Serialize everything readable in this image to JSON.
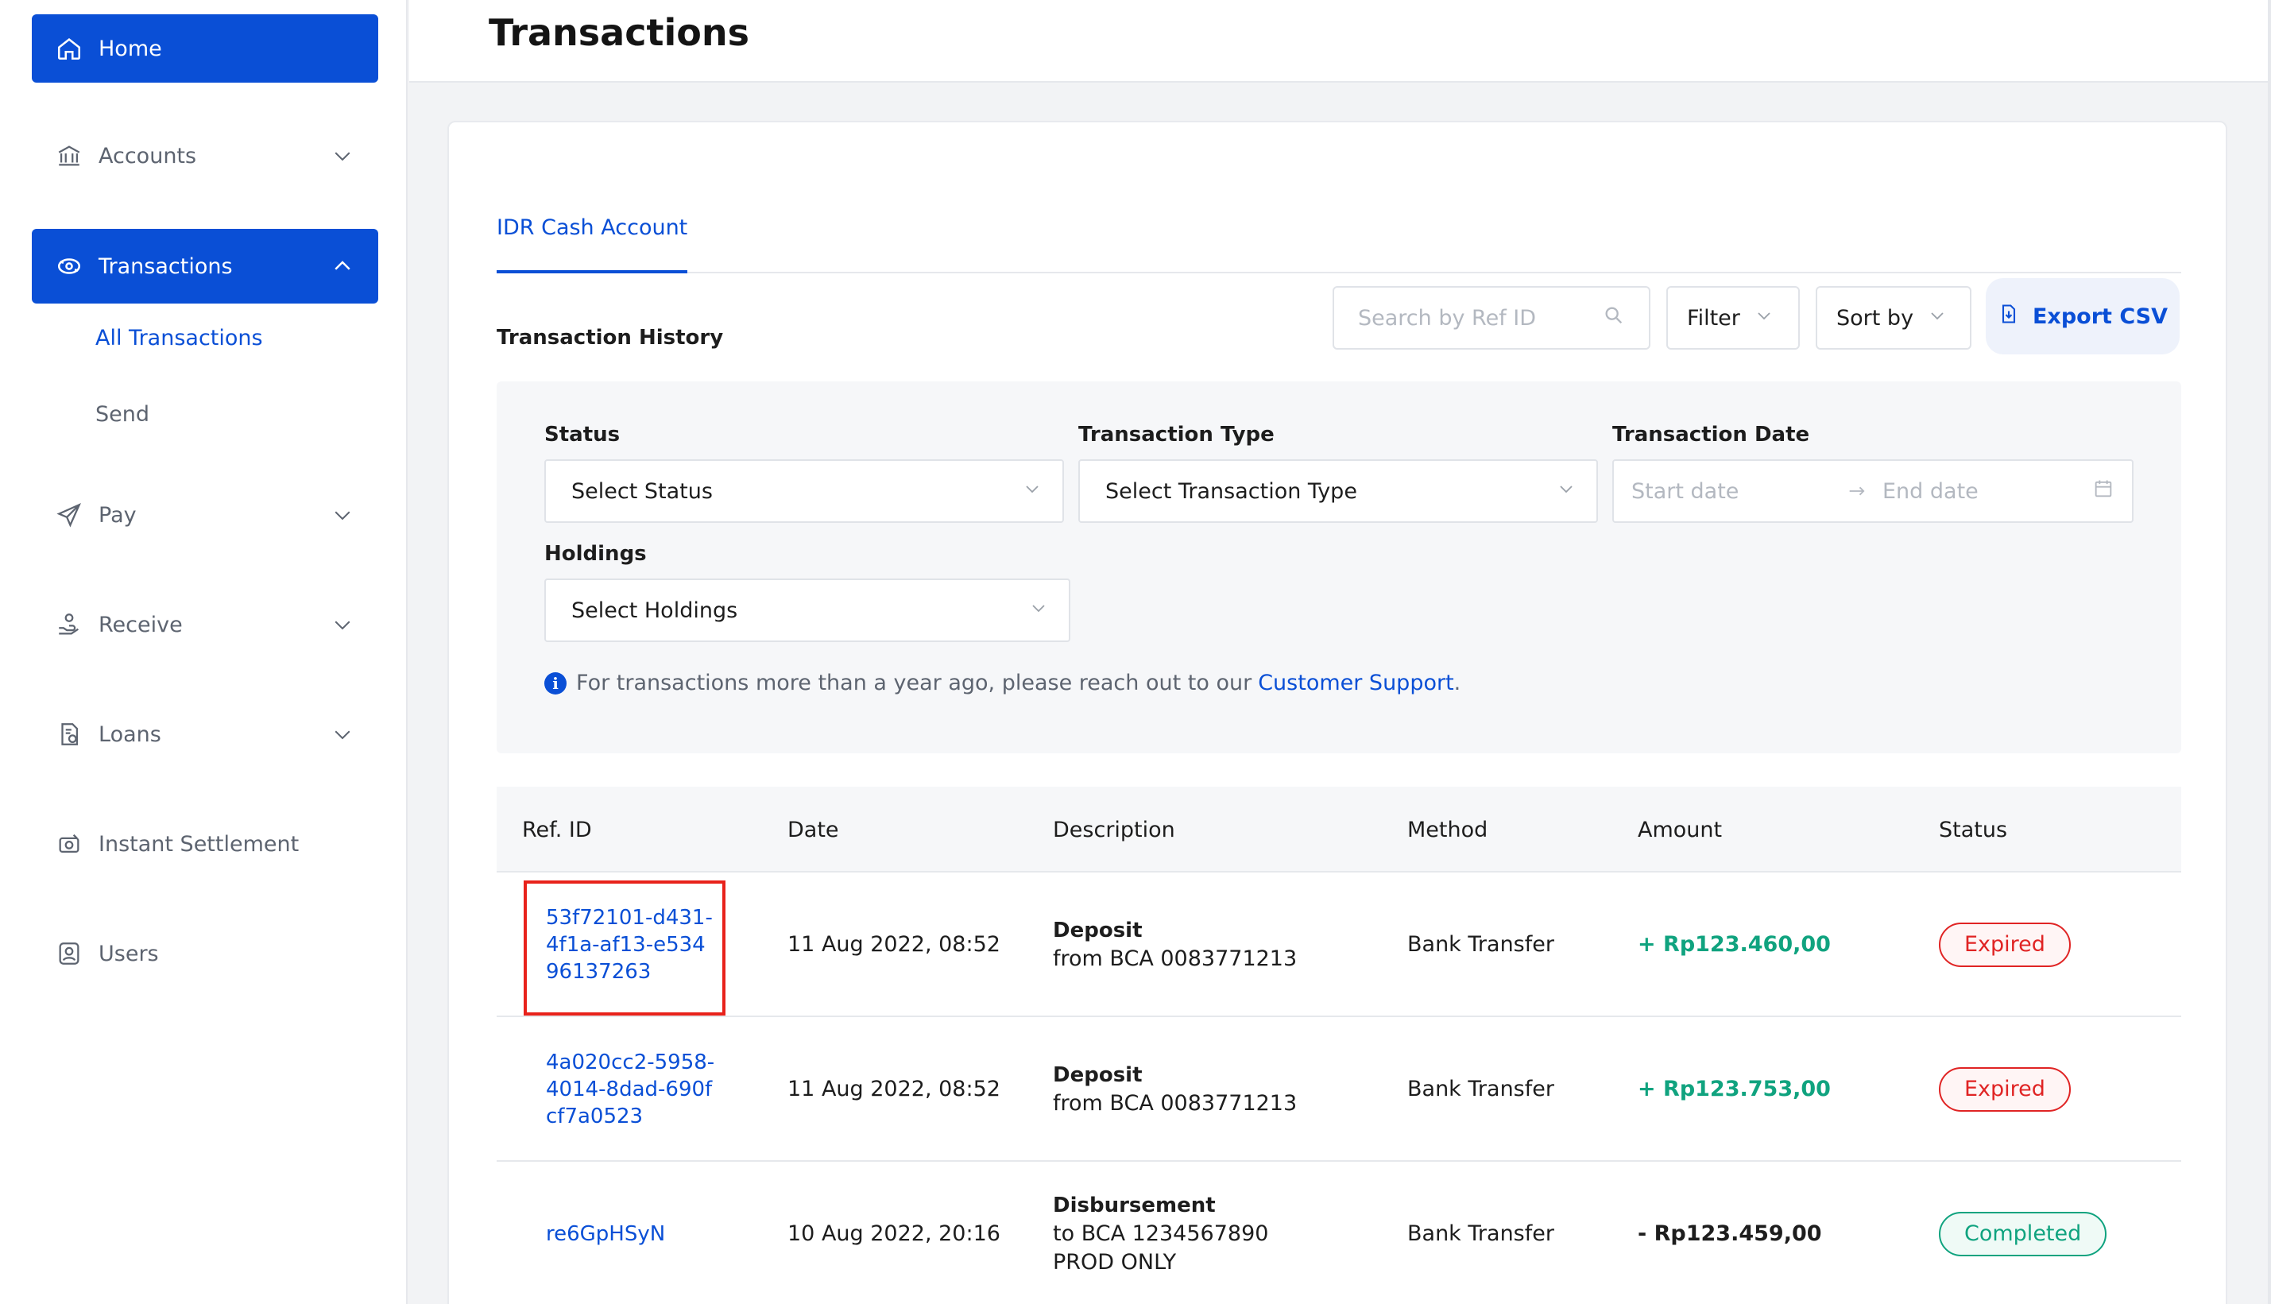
{
  "sidebar": {
    "items": [
      {
        "label": "Home",
        "icon": "home-icon",
        "active": true
      },
      {
        "label": "Accounts",
        "icon": "bank-icon"
      },
      {
        "label": "Transactions",
        "icon": "transactions-icon",
        "active": true
      },
      {
        "label": "Pay",
        "icon": "send-plane-icon"
      },
      {
        "label": "Receive",
        "icon": "receive-hand-icon"
      },
      {
        "label": "Loans",
        "icon": "loan-document-icon"
      },
      {
        "label": "Instant Settlement",
        "icon": "settlement-icon"
      },
      {
        "label": "Users",
        "icon": "user-icon"
      }
    ],
    "sub_items": [
      "All Transactions",
      "Send"
    ]
  },
  "header": {
    "title": "Transactions"
  },
  "tabs": [
    "IDR Cash Account"
  ],
  "history": {
    "title": "Transaction History",
    "search_placeholder": "Search by Ref ID",
    "filter_label": "Filter",
    "sort_label": "Sort by",
    "export_label": "Export CSV"
  },
  "filters": {
    "status_label": "Status",
    "status_value": "Select Status",
    "type_label": "Transaction Type",
    "type_value": "Select Transaction Type",
    "date_label": "Transaction Date",
    "start_placeholder": "Start date",
    "end_placeholder": "End date",
    "holdings_label": "Holdings",
    "holdings_value": "Select Holdings",
    "info_text": "For transactions more than a year ago, please reach out to our",
    "info_link": "Customer Support",
    "info_end": "."
  },
  "table": {
    "columns": [
      "Ref. ID",
      "Date",
      "Description",
      "Method",
      "Amount",
      "Status"
    ],
    "rows": [
      {
        "ref": [
          "53f72101-d431-",
          "4f1a-af13-e534",
          "96137263"
        ],
        "date": "11 Aug 2022, 08:52",
        "desc_type": "Deposit",
        "desc_lines": [
          "from BCA 0083771213"
        ],
        "method": "Bank Transfer",
        "amount": "+ Rp123.460,00",
        "status": "Expired"
      },
      {
        "ref": [
          "4a020cc2-5958-",
          "4014-8dad-690f",
          "cf7a0523"
        ],
        "date": "11 Aug 2022, 08:52",
        "desc_type": "Deposit",
        "desc_lines": [
          "from BCA 0083771213"
        ],
        "method": "Bank Transfer",
        "amount": "+ Rp123.753,00",
        "status": "Expired"
      },
      {
        "ref": [
          "re6GpHSyN"
        ],
        "date": "10 Aug 2022, 20:16",
        "desc_type": "Disbursement",
        "desc_lines": [
          "to BCA 1234567890",
          "PROD ONLY"
        ],
        "method": "Bank Transfer",
        "amount": "- Rp123.459,00",
        "status": "Completed"
      }
    ]
  },
  "colors": {
    "primary": "#0a4fd6",
    "positive": "#10a37f",
    "expired": "#e02424",
    "highlight": "#e8221b"
  }
}
